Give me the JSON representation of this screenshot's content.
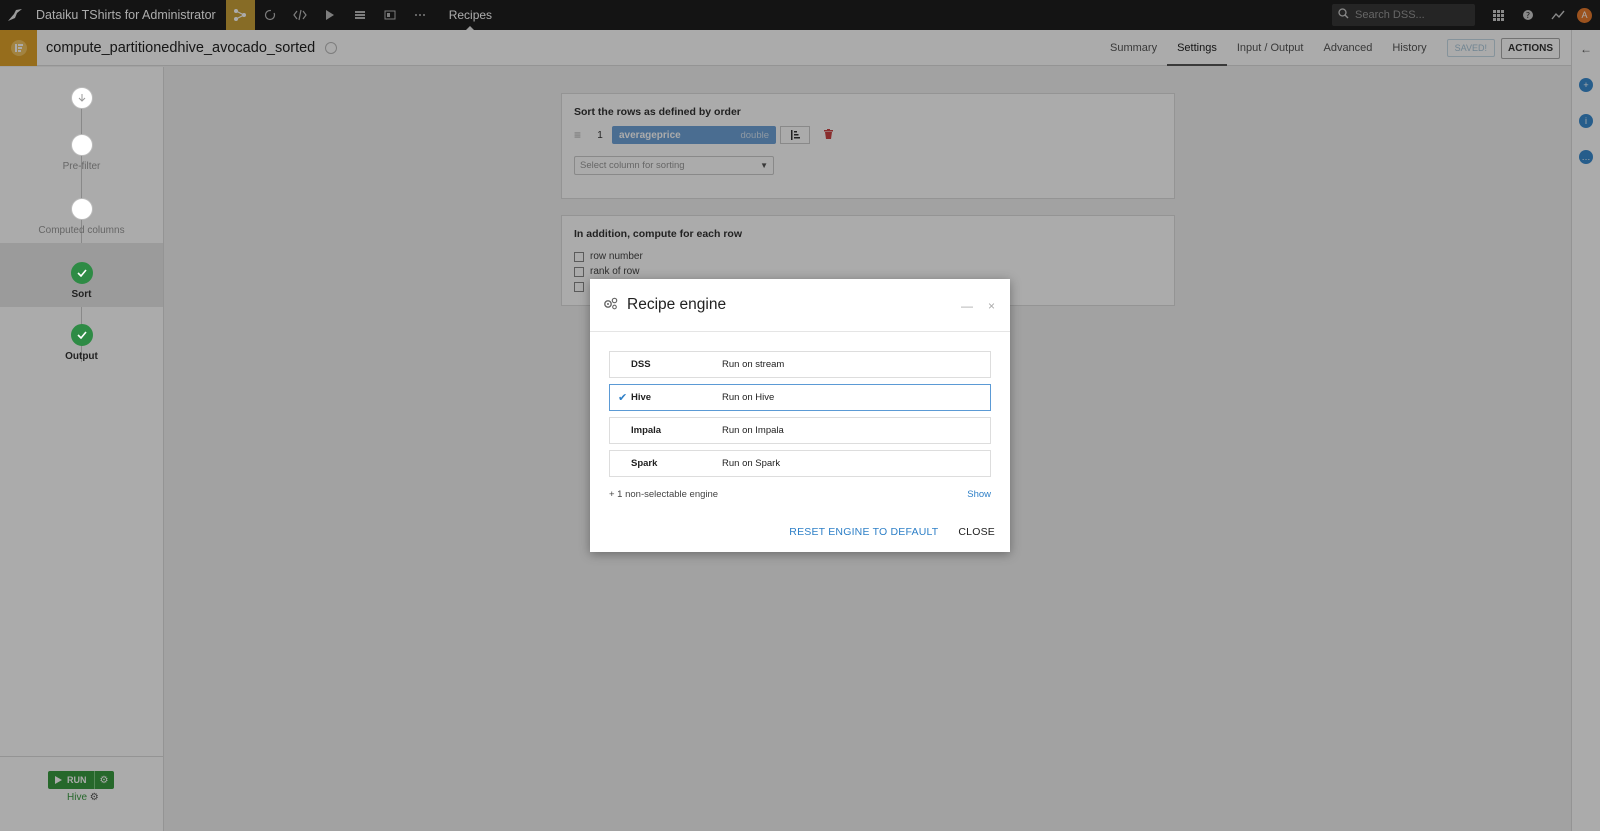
{
  "topbar": {
    "project": "Dataiku TShirts for Administrator",
    "section": "Recipes",
    "search_placeholder": "Search DSS...",
    "avatar": "A",
    "icons": [
      "bird-logo-icon",
      "flow-icon",
      "refresh-icon",
      "code-icon",
      "run-icon",
      "stack-icon",
      "dashboard-icon",
      "more-icon",
      "search-icon",
      "apps-grid-icon",
      "help-icon",
      "activity-icon"
    ]
  },
  "recipe": {
    "title": "compute_partitionedhive_avocado_sorted",
    "tabs": [
      "Summary",
      "Settings",
      "Input / Output",
      "Advanced",
      "History"
    ],
    "active_tab": "Settings",
    "saved_label": "SAVED!",
    "actions_label": "ACTIONS"
  },
  "steps": [
    {
      "label": "",
      "state": "pending"
    },
    {
      "label": "Pre-filter",
      "state": "pending"
    },
    {
      "label": "Computed columns",
      "state": "pending"
    },
    {
      "label": "Sort",
      "state": "done",
      "active": true
    },
    {
      "label": "Output",
      "state": "done"
    }
  ],
  "run": {
    "label": "RUN",
    "engine": "Hive"
  },
  "sort_card": {
    "title": "Sort the rows as defined by order",
    "rows": [
      {
        "index": "1",
        "column": "averageprice",
        "type": "double"
      }
    ],
    "select_placeholder": "Select column for sorting"
  },
  "compute_card": {
    "title": "In addition, compute for each row",
    "options": [
      {
        "label": "row number",
        "checked": false
      },
      {
        "label": "rank of row",
        "checked": false
      },
      {
        "label": "",
        "checked": false
      }
    ]
  },
  "modal": {
    "title": "Recipe engine",
    "engines": [
      {
        "name": "DSS",
        "desc": "Run on stream",
        "selected": false
      },
      {
        "name": "Hive",
        "desc": "Run on Hive",
        "selected": true
      },
      {
        "name": "Impala",
        "desc": "Run on Impala",
        "selected": false
      },
      {
        "name": "Spark",
        "desc": "Run on Spark",
        "selected": false
      }
    ],
    "non_selectable": "+ 1 non-selectable engine",
    "show_label": "Show",
    "reset_label": "RESET ENGINE TO DEFAULT",
    "close_label": "CLOSE"
  },
  "colors": {
    "topbar_bg": "#1f1f1f",
    "flow_accent": "#c9a139",
    "recipe_accent": "#e0a32b",
    "success_green": "#2e8b45",
    "link_blue": "#2d7fc7"
  }
}
